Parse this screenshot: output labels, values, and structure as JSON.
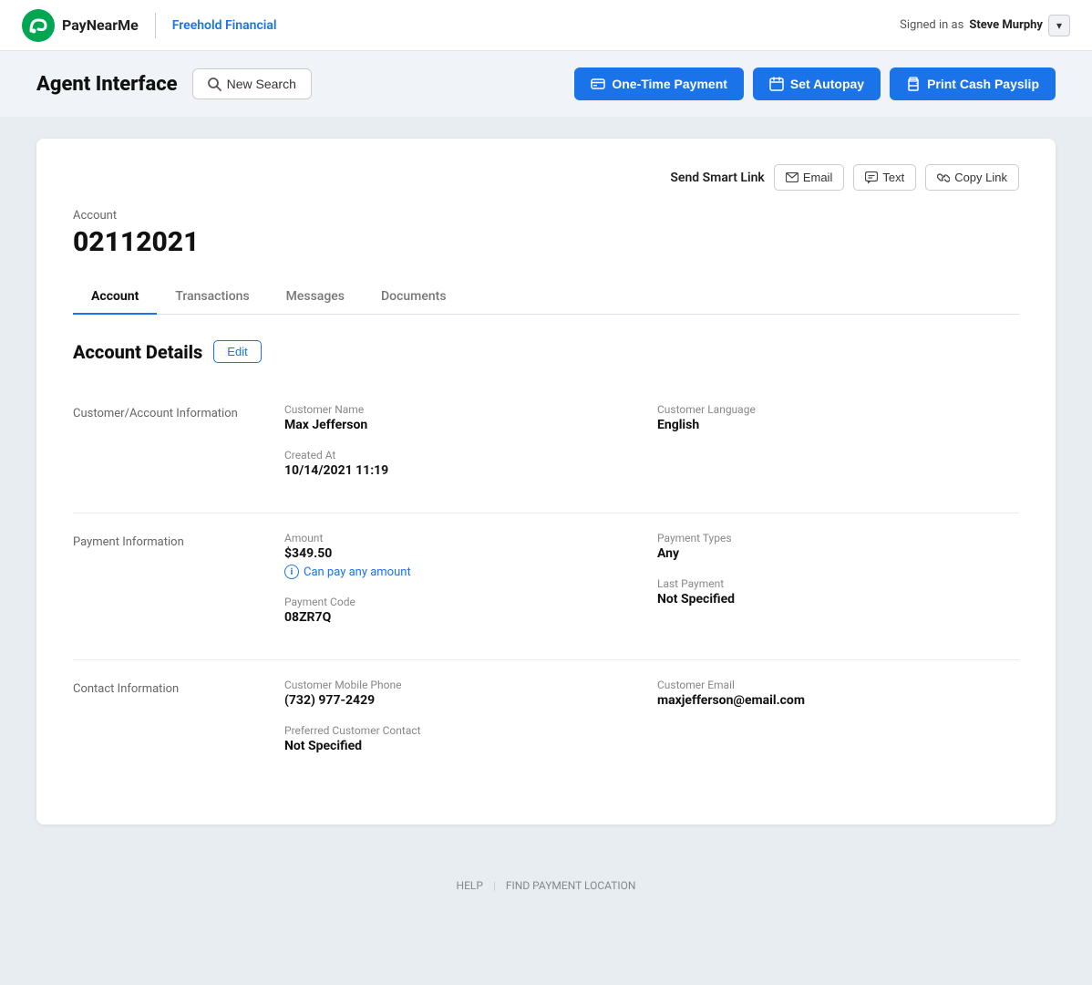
{
  "brand": {
    "name": "Freehold Financial",
    "signed_in_label": "Signed in as",
    "user_name": "Steve Murphy"
  },
  "header": {
    "title": "Agent Interface",
    "new_search_label": "New Search",
    "btn_one_time": "One-Time Payment",
    "btn_autopay": "Set Autopay",
    "btn_print": "Print Cash Payslip"
  },
  "smart_link": {
    "label": "Send Smart Link",
    "btn_email": "Email",
    "btn_text": "Text",
    "btn_copy": "Copy Link"
  },
  "account": {
    "label": "Account",
    "id": "02112021"
  },
  "tabs": [
    {
      "label": "Account",
      "active": true
    },
    {
      "label": "Transactions",
      "active": false
    },
    {
      "label": "Messages",
      "active": false
    },
    {
      "label": "Documents",
      "active": false
    }
  ],
  "account_details": {
    "title": "Account Details",
    "edit_label": "Edit",
    "sections": [
      {
        "name": "Customer/Account Information",
        "fields": [
          {
            "label": "Customer Name",
            "value": "Max Jefferson",
            "col": 1,
            "row": 1
          },
          {
            "label": "Customer Language",
            "value": "English",
            "col": 2,
            "row": 1
          },
          {
            "label": "Created At",
            "value": "10/14/2021 11:19",
            "col": 1,
            "row": 2
          }
        ]
      },
      {
        "name": "Payment Information",
        "fields": [
          {
            "label": "Amount",
            "value": "$349.50",
            "sub": "Can pay any amount",
            "col": 1,
            "row": 1
          },
          {
            "label": "Payment Types",
            "value": "Any",
            "col": 2,
            "row": 1
          },
          {
            "label": "Payment Code",
            "value": "08ZR7Q",
            "col": 1,
            "row": 2
          },
          {
            "label": "Last Payment",
            "value": "Not Specified",
            "col": 2,
            "row": 2
          }
        ]
      },
      {
        "name": "Contact Information",
        "fields": [
          {
            "label": "Customer Mobile Phone",
            "value": "(732) 977-2429",
            "col": 1,
            "row": 1
          },
          {
            "label": "Customer Email",
            "value": "maxjefferson@email.com",
            "col": 2,
            "row": 1
          },
          {
            "label": "Preferred Customer Contact",
            "value": "Not Specified",
            "col": 1,
            "row": 2
          }
        ]
      }
    ]
  },
  "footer": {
    "help": "HELP",
    "find_payment": "FIND PAYMENT LOCATION"
  }
}
